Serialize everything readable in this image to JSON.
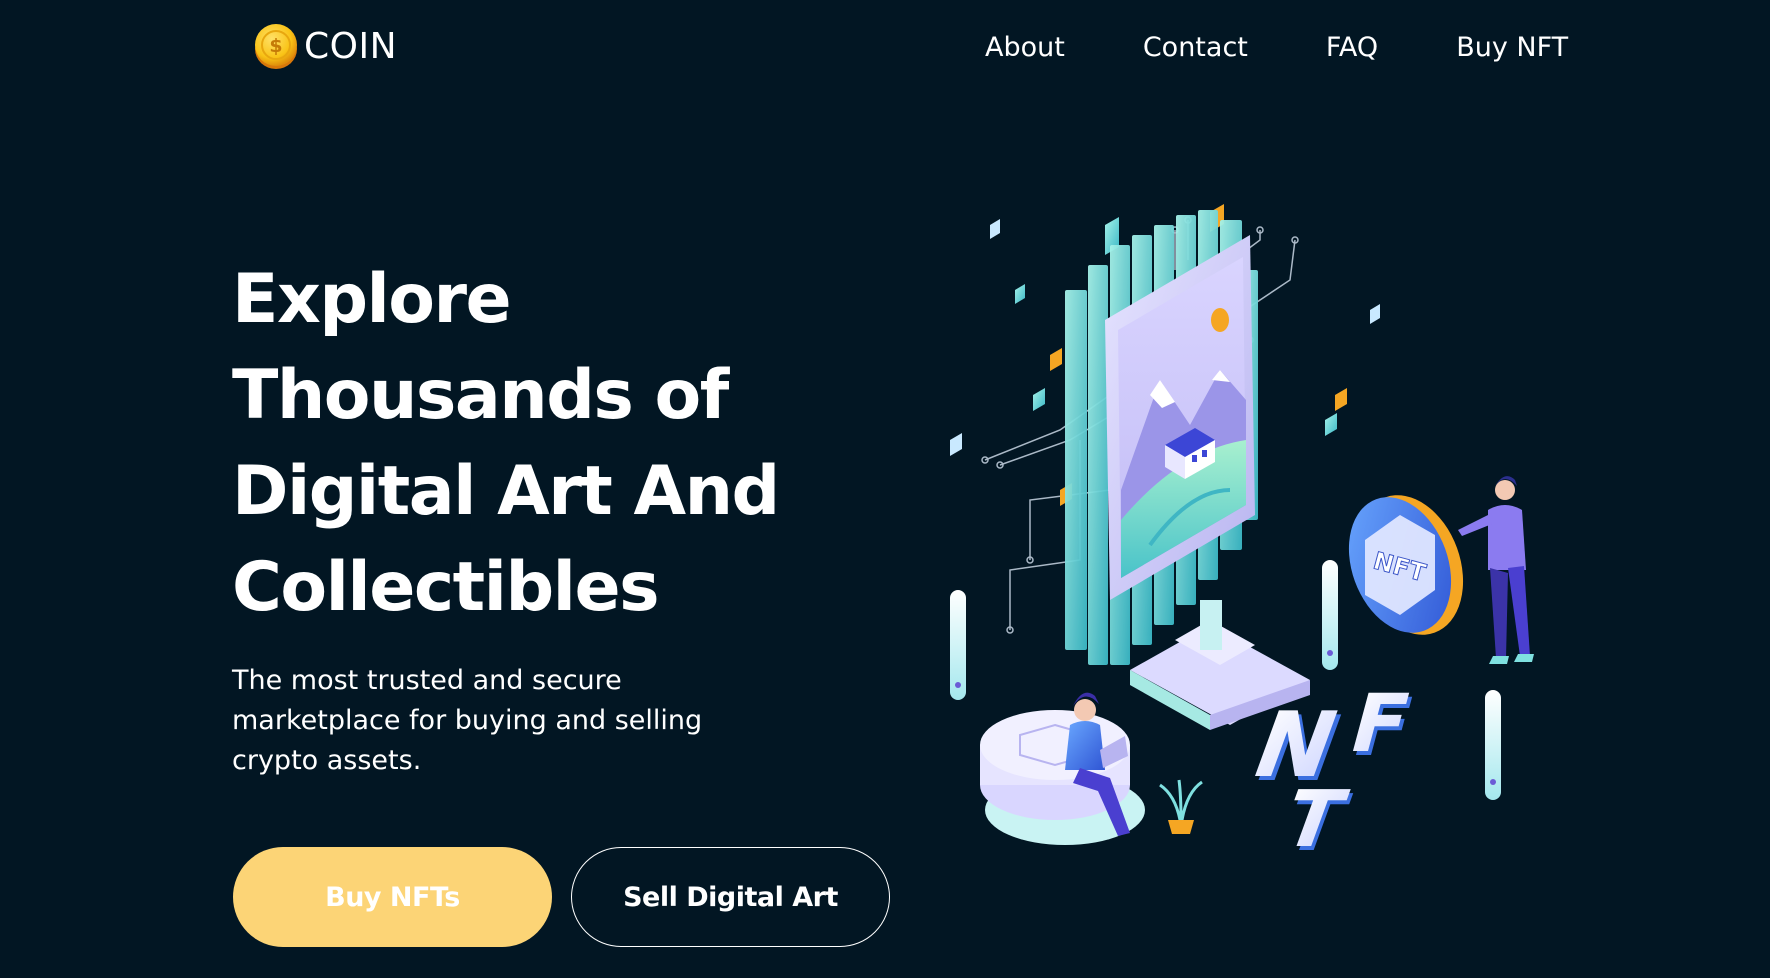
{
  "brand": {
    "name": "COIN",
    "coin_symbol": "$",
    "coin_color": "#f9c316"
  },
  "nav": {
    "items": [
      {
        "label": "About"
      },
      {
        "label": "Contact"
      },
      {
        "label": "FAQ"
      },
      {
        "label": "Buy NFT"
      }
    ]
  },
  "hero": {
    "title_lines": [
      "Explore",
      "Thousands of",
      "Digital Art And",
      "Collectibles"
    ],
    "subtitle": "The most trusted and secure marketplace for buying and selling crypto assets.",
    "primary_button": "Buy NFTs",
    "secondary_button": "Sell Digital Art"
  },
  "illustration": {
    "coin_label": "NFT",
    "letters": [
      "N",
      "F",
      "T"
    ]
  },
  "colors": {
    "background": "#021623",
    "accent_yellow": "#fcd476",
    "accent_cyan": "#7fe0e0",
    "accent_blue": "#3b6fe0",
    "accent_orange": "#f5a623"
  }
}
